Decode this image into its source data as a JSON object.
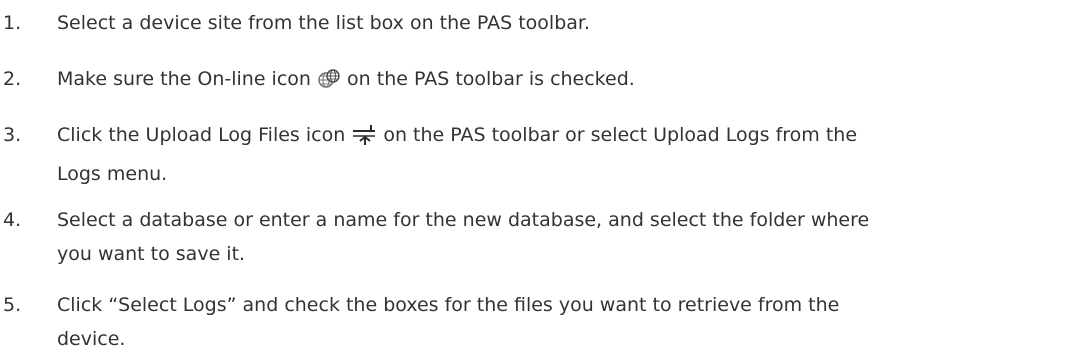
{
  "steps": [
    {
      "number": "1.",
      "lines": [
        "Select a device site from the list box on the PAS toolbar."
      ]
    },
    {
      "number": "2.",
      "before_icon": "Make sure the On-line icon",
      "icon": "online-globe-icon",
      "after_icon": "on the PAS toolbar is checked."
    },
    {
      "number": "3.",
      "before_icon": "Click the Upload Log Files icon",
      "icon": "upload-log-files-icon",
      "after_icon": "on the PAS toolbar or select Upload Logs from the",
      "line2": "Logs menu."
    },
    {
      "number": "4.",
      "lines": [
        "Select a database or enter a name for the new database, and select the folder where",
        "you want to save it."
      ]
    },
    {
      "number": "5.",
      "lines": [
        "Click “Select Logs” and check the boxes for the files you want to retrieve from the",
        "device."
      ]
    }
  ],
  "colors": {
    "text": "#333333",
    "icon_gray": "#7a7a7a",
    "icon_dark": "#2b2b2b"
  }
}
